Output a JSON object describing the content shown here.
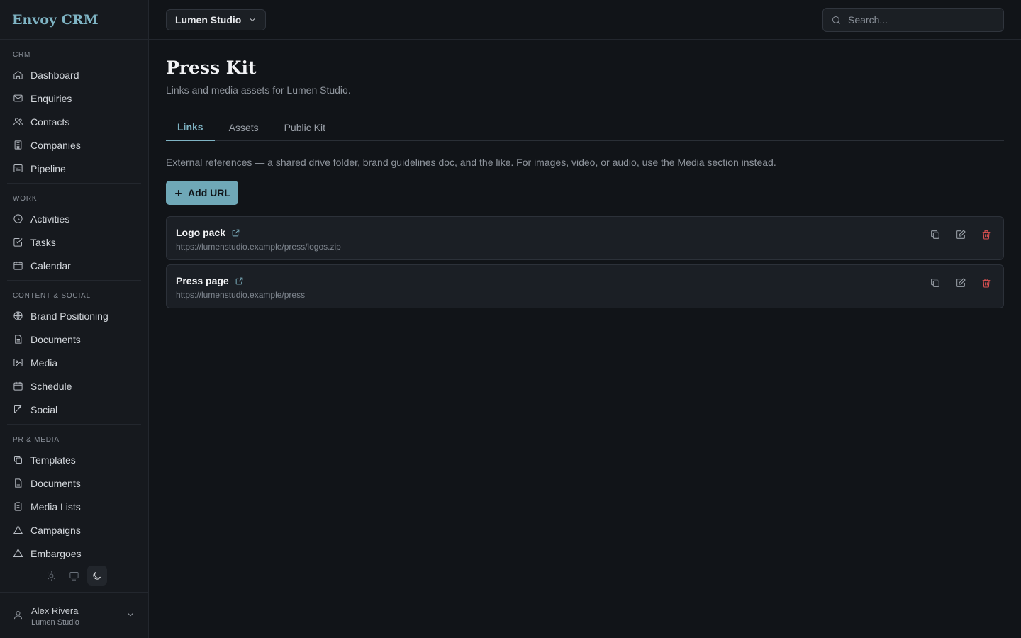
{
  "app": {
    "name": "Envoy CRM"
  },
  "sidebar": {
    "sections": [
      {
        "label": "CRM",
        "items": [
          {
            "label": "Dashboard",
            "icon": "home-icon"
          },
          {
            "label": "Enquiries",
            "icon": "mail-icon"
          },
          {
            "label": "Contacts",
            "icon": "users-icon"
          },
          {
            "label": "Companies",
            "icon": "building-icon"
          },
          {
            "label": "Pipeline",
            "icon": "pipeline-icon"
          }
        ]
      },
      {
        "label": "WORK",
        "items": [
          {
            "label": "Activities",
            "icon": "clock-icon"
          },
          {
            "label": "Tasks",
            "icon": "checkbox-icon"
          },
          {
            "label": "Calendar",
            "icon": "calendar-icon"
          }
        ]
      },
      {
        "label": "CONTENT & SOCIAL",
        "items": [
          {
            "label": "Brand Positioning",
            "icon": "globe-icon"
          },
          {
            "label": "Documents",
            "icon": "document-icon"
          },
          {
            "label": "Media",
            "icon": "image-icon"
          },
          {
            "label": "Schedule",
            "icon": "calendar-icon"
          },
          {
            "label": "Social",
            "icon": "send-icon"
          }
        ]
      },
      {
        "label": "PR & MEDIA",
        "items": [
          {
            "label": "Templates",
            "icon": "copy-icon"
          },
          {
            "label": "Documents",
            "icon": "document-icon"
          },
          {
            "label": "Media Lists",
            "icon": "clipboard-icon"
          },
          {
            "label": "Campaigns",
            "icon": "campaign-icon"
          },
          {
            "label": "Embargoes",
            "icon": "warning-icon"
          }
        ]
      }
    ],
    "theme": {
      "options": [
        "sun-icon",
        "monitor-icon",
        "moon-icon"
      ],
      "selected": "moon-icon"
    },
    "user": {
      "name": "Alex Rivera",
      "org": "Lumen Studio"
    }
  },
  "topbar": {
    "org_switcher": "Lumen Studio",
    "search_placeholder": "Search..."
  },
  "page": {
    "title": "Press Kit",
    "subtitle": "Links and media assets for Lumen Studio.",
    "tabs": [
      {
        "label": "Links",
        "active": true
      },
      {
        "label": "Assets",
        "active": false
      },
      {
        "label": "Public Kit",
        "active": false
      }
    ],
    "help_text": "External references — a shared drive folder, brand guidelines doc, and the like. For images, video, or audio, use the Media section instead.",
    "add_button": "Add URL",
    "links": [
      {
        "title": "Logo pack",
        "url": "https://lumenstudio.example/press/logos.zip"
      },
      {
        "title": "Press page",
        "url": "https://lumenstudio.example/press"
      }
    ]
  },
  "colors": {
    "accent": "#7fb4c4",
    "button": "#6fa8b7",
    "danger": "#e05252",
    "background": "#111418"
  }
}
